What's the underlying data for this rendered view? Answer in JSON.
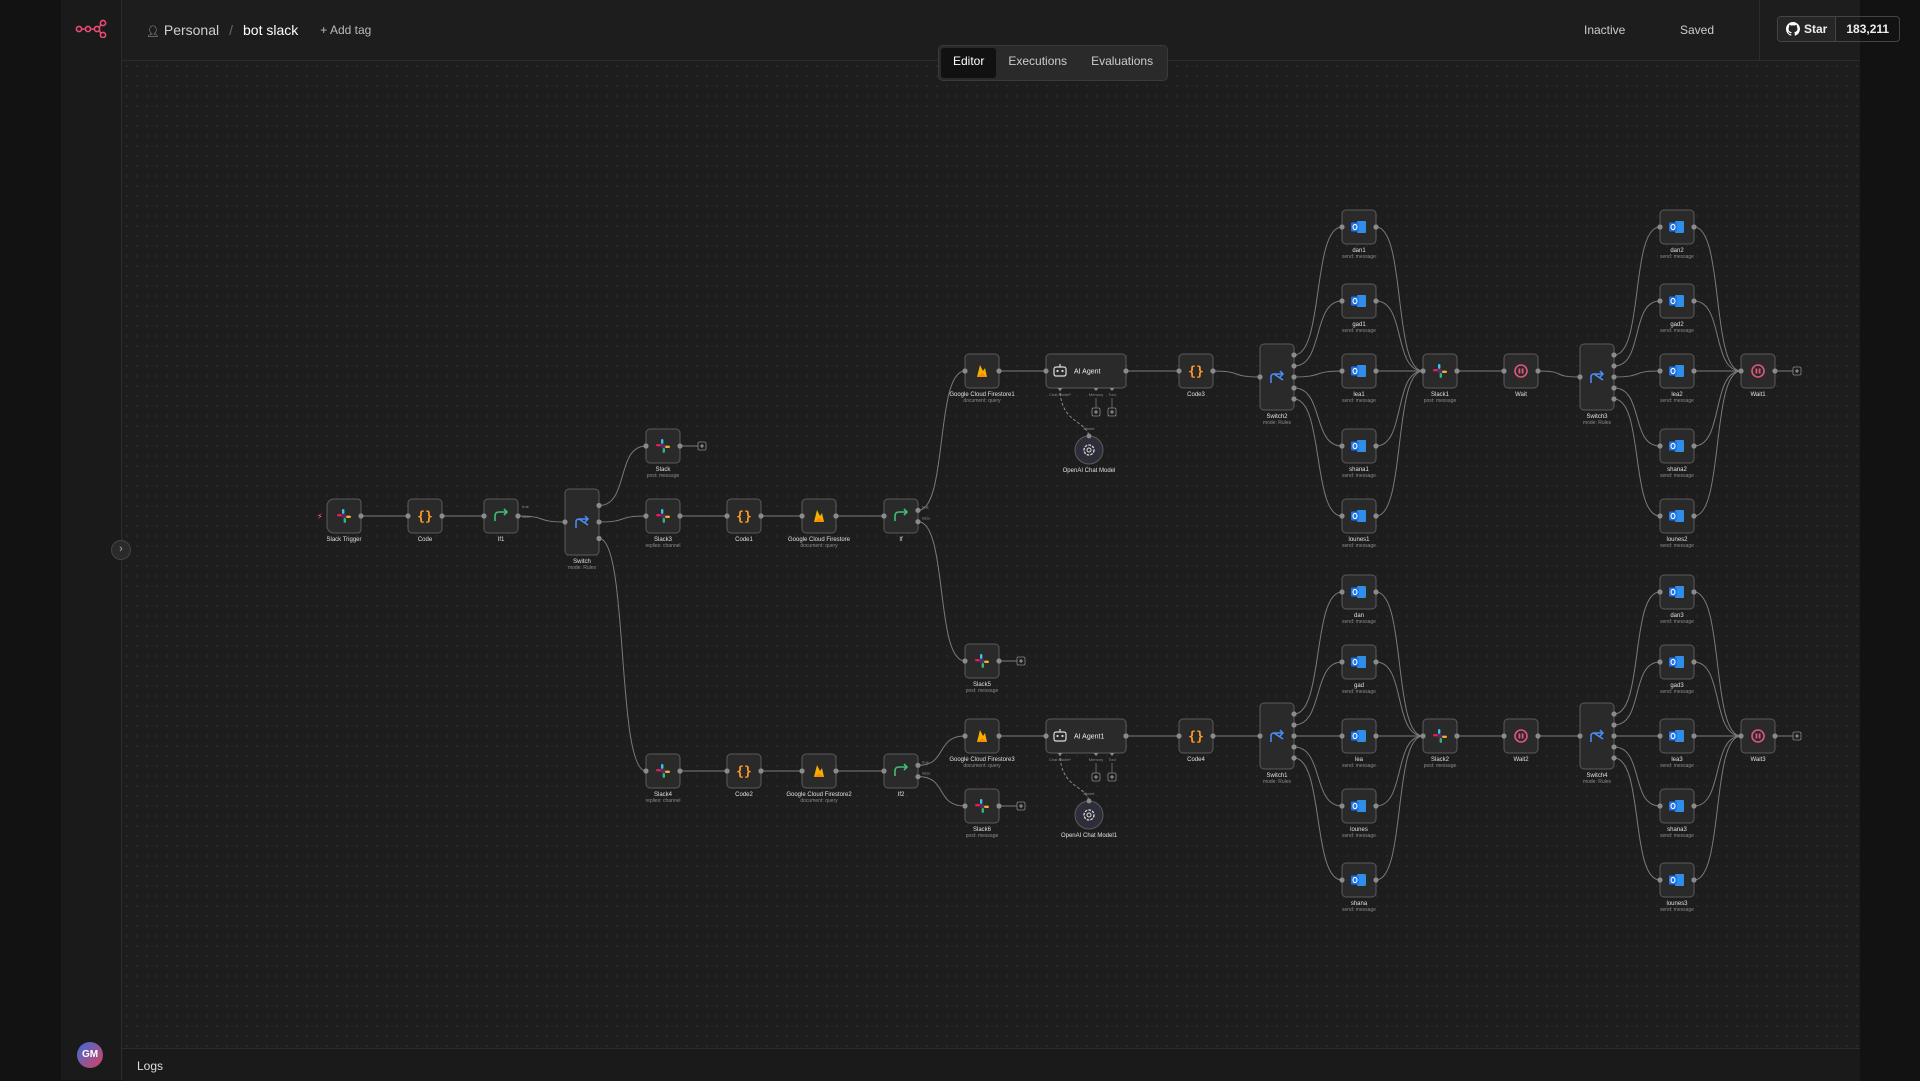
{
  "header": {
    "project": "Personal",
    "workflow_name": "bot slack",
    "add_tag": "+ Add tag",
    "status": "Inactive",
    "save_state": "Saved",
    "github_star": "Star",
    "github_count": "183,211"
  },
  "tabs": [
    "Editor",
    "Executions",
    "Evaluations"
  ],
  "active_tab": "Editor",
  "sidebar": {
    "avatar_initials": "GM"
  },
  "logs": {
    "label": "Logs"
  },
  "colors": {
    "slack": "#e01e5a",
    "code": "#ff9b26",
    "if": "#3fbd74",
    "switch": "#4c8ef7",
    "firestore": "#f6b100",
    "outlook": "#1e73e8",
    "wait": "#e0567a"
  },
  "nodes": [
    {
      "name": "Slack Trigger",
      "sub": "",
      "icon": "slack-icon"
    },
    {
      "name": "Code",
      "sub": "",
      "icon": "code-icon"
    },
    {
      "name": "If1",
      "sub": "",
      "icon": "if-icon"
    },
    {
      "name": "Switch",
      "sub": "mode: Rules",
      "icon": "switch-icon"
    },
    {
      "name": "Slack",
      "sub": "post: message",
      "icon": "slack-icon"
    },
    {
      "name": "Slack3",
      "sub": "replies: channel",
      "icon": "slack-icon"
    },
    {
      "name": "Code1",
      "sub": "",
      "icon": "code-icon"
    },
    {
      "name": "Google Cloud Firestore",
      "sub": "document: query",
      "icon": "firestore-icon"
    },
    {
      "name": "If",
      "sub": "",
      "icon": "if-icon"
    },
    {
      "name": "Slack4",
      "sub": "replies: channel",
      "icon": "slack-icon"
    },
    {
      "name": "Code2",
      "sub": "",
      "icon": "code-icon"
    },
    {
      "name": "Google Cloud Firestore2",
      "sub": "document: query",
      "icon": "firestore-icon"
    },
    {
      "name": "If2",
      "sub": "",
      "icon": "if-icon"
    },
    {
      "name": "Google Cloud Firestore1",
      "sub": "document: query",
      "icon": "firestore-icon"
    },
    {
      "name": "Slack5",
      "sub": "post: message",
      "icon": "slack-icon"
    },
    {
      "name": "Google Cloud Firestore3",
      "sub": "document: query",
      "icon": "firestore-icon"
    },
    {
      "name": "Slack6",
      "sub": "post: message",
      "icon": "slack-icon"
    },
    {
      "name": "Code3",
      "sub": "",
      "icon": "code-icon"
    },
    {
      "name": "Switch2",
      "sub": "mode: Rules",
      "icon": "switch-icon"
    },
    {
      "name": "dan1",
      "sub": "send: message",
      "icon": "outlook-icon"
    },
    {
      "name": "gad1",
      "sub": "send: message",
      "icon": "outlook-icon"
    },
    {
      "name": "lea1",
      "sub": "send: message",
      "icon": "outlook-icon"
    },
    {
      "name": "shana1",
      "sub": "send: message",
      "icon": "outlook-icon"
    },
    {
      "name": "lounes1",
      "sub": "send: message",
      "icon": "outlook-icon"
    },
    {
      "name": "Slack1",
      "sub": "post: message",
      "icon": "slack-icon"
    },
    {
      "name": "Wait",
      "sub": "",
      "icon": "wait-icon"
    },
    {
      "name": "Switch3",
      "sub": "mode: Rules",
      "icon": "switch-icon"
    },
    {
      "name": "dan2",
      "sub": "send: message",
      "icon": "outlook-icon"
    },
    {
      "name": "gad2",
      "sub": "send: message",
      "icon": "outlook-icon"
    },
    {
      "name": "lea2",
      "sub": "send: message",
      "icon": "outlook-icon"
    },
    {
      "name": "shana2",
      "sub": "send: message",
      "icon": "outlook-icon"
    },
    {
      "name": "lounes2",
      "sub": "send: message",
      "icon": "outlook-icon"
    },
    {
      "name": "Wait1",
      "sub": "",
      "icon": "wait-icon"
    },
    {
      "name": "Code4",
      "sub": "",
      "icon": "code-icon"
    },
    {
      "name": "Switch1",
      "sub": "mode: Rules",
      "icon": "switch-icon"
    },
    {
      "name": "dan",
      "sub": "send: message",
      "icon": "outlook-icon"
    },
    {
      "name": "gad",
      "sub": "send: message",
      "icon": "outlook-icon"
    },
    {
      "name": "lea",
      "sub": "send: message",
      "icon": "outlook-icon"
    },
    {
      "name": "lounes",
      "sub": "send: message",
      "icon": "outlook-icon"
    },
    {
      "name": "shana",
      "sub": "send: message",
      "icon": "outlook-icon"
    },
    {
      "name": "Slack2",
      "sub": "post: message",
      "icon": "slack-icon"
    },
    {
      "name": "Wait2",
      "sub": "",
      "icon": "wait-icon"
    },
    {
      "name": "Switch4",
      "sub": "mode: Rules",
      "icon": "switch-icon"
    },
    {
      "name": "dan3",
      "sub": "send: message",
      "icon": "outlook-icon"
    },
    {
      "name": "gad3",
      "sub": "send: message",
      "icon": "outlook-icon"
    },
    {
      "name": "lea3",
      "sub": "send: message",
      "icon": "outlook-icon"
    },
    {
      "name": "shana3",
      "sub": "send: message",
      "icon": "outlook-icon"
    },
    {
      "name": "lounes3",
      "sub": "send: message",
      "icon": "outlook-icon"
    },
    {
      "name": "Wait3",
      "sub": "",
      "icon": "wait-icon"
    }
  ],
  "agents": [
    {
      "name": "AI Agent",
      "icon": "robot-icon"
    },
    {
      "name": "AI Agent1",
      "icon": "robot-icon"
    }
  ],
  "agent_handles": [
    "Chat Model*",
    "Memory",
    "Tool"
  ],
  "chat_models": [
    {
      "name": "OpenAI Chat Model",
      "label": "Model",
      "icon": "openai-icon"
    },
    {
      "name": "OpenAI Chat Model1",
      "label": "Model",
      "icon": "openai-icon"
    }
  ],
  "if_handle_labels": [
    "true",
    "false"
  ]
}
